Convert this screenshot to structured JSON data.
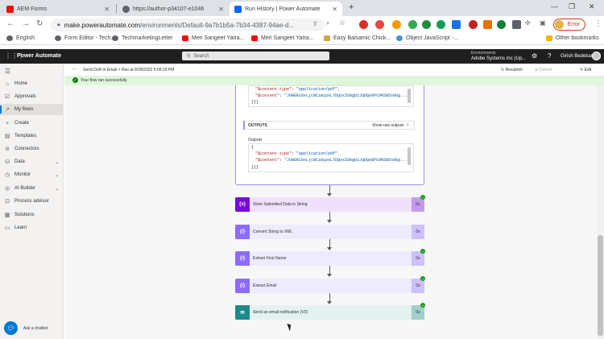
{
  "browser": {
    "tabs": [
      {
        "label": "AEM Forms",
        "active": false
      },
      {
        "label": "https://author-p34107-e1046",
        "active": false
      },
      {
        "label": "Run History | Power Automate",
        "active": true
      }
    ],
    "new_tab": "+",
    "url_host": "make.powerautomate.com",
    "url_path": "/environments/Default-9a7b1b5a-7b34-4387-94ae-d...",
    "error_label": "Error",
    "bookmarks": [
      "English",
      "Form Editor - Tech...",
      "TechmarketingLetter",
      "Meri Sangeet Yatra...",
      "Meri Sangeet Yatra...",
      "Easy Balsamic Chick...",
      "Object JavaScript -...",
      "Other bookmarks"
    ]
  },
  "app": {
    "title": "Power Automate",
    "search_placeholder": "Search",
    "environment_label": "Environments",
    "environment_name": "Adobe Systems Inc (Up...",
    "user_name": "Girish Bedekar"
  },
  "nav": {
    "items": [
      {
        "label": "Home",
        "icon": "home-icon",
        "active": false,
        "chevron": false
      },
      {
        "label": "Approvals",
        "icon": "approvals-icon",
        "active": false,
        "chevron": false
      },
      {
        "label": "My flows",
        "icon": "flows-icon",
        "active": true,
        "chevron": false
      },
      {
        "label": "Create",
        "icon": "plus-icon",
        "active": false,
        "chevron": false
      },
      {
        "label": "Templates",
        "icon": "templates-icon",
        "active": false,
        "chevron": false
      },
      {
        "label": "Connectors",
        "icon": "connectors-icon",
        "active": false,
        "chevron": false
      },
      {
        "label": "Data",
        "icon": "data-icon",
        "active": false,
        "chevron": true
      },
      {
        "label": "Monitor",
        "icon": "monitor-icon",
        "active": false,
        "chevron": true
      },
      {
        "label": "AI Builder",
        "icon": "ai-builder-icon",
        "active": false,
        "chevron": true
      },
      {
        "label": "Process advisor",
        "icon": "process-advisor-icon",
        "active": false,
        "chevron": false
      },
      {
        "label": "Solutions",
        "icon": "solutions-icon",
        "active": false,
        "chevron": false
      },
      {
        "label": "Learn",
        "icon": "learn-icon",
        "active": false,
        "chevron": false
      }
    ],
    "chatbot_label": "Ask a chatbot"
  },
  "command_bar": {
    "title": "Send DoR in Email > Ran at 8/28/2022 5:09:33 PM",
    "resubmit": "Resubmit",
    "cancel": "Cancel",
    "edit": "Edit"
  },
  "banner": {
    "text": "Your flow ran successfully."
  },
  "expanded_card": {
    "input_lines": [
      {
        "key": "\"$content-type\"",
        "value": "\"application/pdf\","
      },
      {
        "key": "\"$content\"",
        "value": "\"JVBERi0xLjcNCiWipsL7DQoxIDAgb2JqDQo8PC9MZW5ndGg..."
      },
      {
        "key": "}}}",
        "value": ""
      }
    ],
    "outputs_label": "OUTPUTS",
    "show_raw_outputs": "Show raw outputs",
    "outputs_sublabel": "Outputs",
    "output_lines": [
      {
        "key": "{",
        "value": ""
      },
      {
        "key": "\"$content-type\"",
        "value": "\"application/pdf\","
      },
      {
        "key": "\"$content\"",
        "value": "\"JVBERi0xLjcNCiWipsL7DQoxIDAgb2JqDQo8PC9MZW5ndGg..."
      },
      {
        "key": "}}}",
        "value": ""
      }
    ]
  },
  "actions": [
    {
      "label": "Store Submitted Data in String",
      "icon": "variable-icon",
      "glyph": "{x}",
      "time": "0s",
      "color": "#770bd6",
      "bg": "#efe0fb",
      "checked": true
    },
    {
      "label": "Convert String to XML",
      "icon": "expression-icon",
      "glyph": "{/}",
      "time": "0s",
      "color": "#8c6cff",
      "bg": "#eeeaff",
      "checked": false
    },
    {
      "label": "Extract First Name",
      "icon": "expression-icon",
      "glyph": "{/}",
      "time": "0s",
      "color": "#8c6cff",
      "bg": "#eeeaff",
      "checked": true
    },
    {
      "label": "Extract Email",
      "icon": "expression-icon",
      "glyph": "{/}",
      "time": "0s",
      "color": "#8c6cff",
      "bg": "#eeeaff",
      "checked": true
    },
    {
      "label": "Send an email notification (V3)",
      "icon": "mail-icon",
      "glyph": "✉",
      "time": "0s",
      "color": "#1f8a8a",
      "bg": "#e1f2f1",
      "checked": true
    }
  ]
}
